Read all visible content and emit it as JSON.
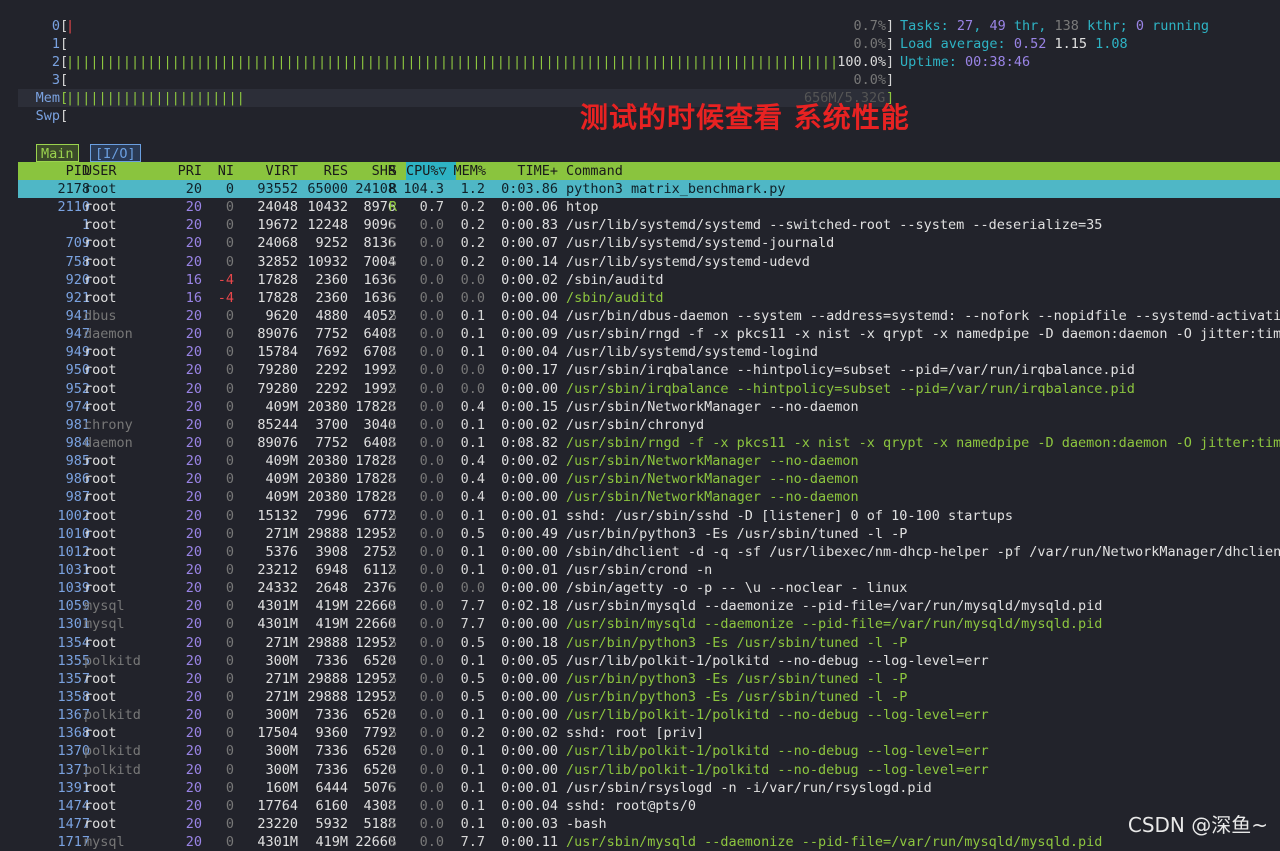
{
  "meters": {
    "cpus": [
      {
        "label": "0",
        "bar": "|",
        "bar_color": "red",
        "pct": "0.7%"
      },
      {
        "label": "1",
        "bar": "",
        "bar_color": "green",
        "pct": "0.0%"
      },
      {
        "label": "2",
        "bar": "||||||||||||||||||||||||||||||||||||||||||||||||||||||||||||||||||||||||||||||||||||||||||||||||||||||||||||",
        "bar_color": "green",
        "pct": "100.0%"
      },
      {
        "label": "3",
        "bar": "",
        "bar_color": "green",
        "pct": "0.0%"
      }
    ],
    "mem": {
      "label": "Mem",
      "bar": "|||||||||||||||||||||||||",
      "value": "656M/5.32G"
    },
    "swp": {
      "label": "Swp",
      "bar": "",
      "value": ""
    }
  },
  "header": {
    "tasks_label": "Tasks:",
    "tasks": "27",
    "thr_count": "49",
    "thr_label": "thr,",
    "kthr_count": "138",
    "kthr_label": "kthr;",
    "running": "0",
    "running_label": "running",
    "load_label": "Load average:",
    "load1": "0.52",
    "load5": "1.15",
    "load15": "1.08",
    "uptime_label": "Uptime:",
    "uptime": "00:38:46"
  },
  "overlay_text": "测试的时候查看 系统性能",
  "tabs": {
    "main": "Main",
    "io": "[I/O]"
  },
  "columns": {
    "pid": "PID",
    "user": "USER",
    "pri": "PRI",
    "ni": "NI",
    "virt": "VIRT",
    "res": "RES",
    "shr": "SHR",
    "s": "S",
    "cpu": "CPU%",
    "sort_icon": "▽",
    "mem": "MEM%",
    "time": "TIME+",
    "cmd": "Command"
  },
  "processes": [
    {
      "pid": "2178",
      "user": "root",
      "pri": "20",
      "ni": "0",
      "virt": "93552",
      "res": "65000",
      "shr": "24108",
      "s": "R",
      "cpu": "104.3",
      "mem": "1.2",
      "time": "0:03.86",
      "cmd": "python3 matrix_benchmark.py",
      "sel": true
    },
    {
      "pid": "2110",
      "user": "root",
      "pri": "20",
      "ni": "0",
      "virt": "24048",
      "res": "10432",
      "shr": "8976",
      "s": "R",
      "cpu": "0.7",
      "mem": "0.2",
      "time": "0:00.06",
      "cmd": "htop"
    },
    {
      "pid": "1",
      "user": "root",
      "pri": "20",
      "ni": "0",
      "virt": "19672",
      "res": "12248",
      "shr": "9096",
      "s": "S",
      "cpu": "0.0",
      "mem": "0.2",
      "time": "0:00.83",
      "cmd": "/usr/lib/systemd/systemd --switched-root --system --deserialize=35"
    },
    {
      "pid": "709",
      "user": "root",
      "pri": "20",
      "ni": "0",
      "virt": "24068",
      "res": "9252",
      "shr": "8136",
      "s": "S",
      "cpu": "0.0",
      "mem": "0.2",
      "time": "0:00.07",
      "cmd": "/usr/lib/systemd/systemd-journald"
    },
    {
      "pid": "758",
      "user": "root",
      "pri": "20",
      "ni": "0",
      "virt": "32852",
      "res": "10932",
      "shr": "7004",
      "s": "S",
      "cpu": "0.0",
      "mem": "0.2",
      "time": "0:00.14",
      "cmd": "/usr/lib/systemd/systemd-udevd"
    },
    {
      "pid": "920",
      "user": "root",
      "pri": "16",
      "ni": "-4",
      "virt": "17828",
      "res": "2360",
      "shr": "1636",
      "s": "S",
      "cpu": "0.0",
      "mem": "0.0",
      "time": "0:00.02",
      "cmd": "/sbin/auditd"
    },
    {
      "pid": "921",
      "user": "root",
      "pri": "16",
      "ni": "-4",
      "virt": "17828",
      "res": "2360",
      "shr": "1636",
      "s": "S",
      "cpu": "0.0",
      "mem": "0.0",
      "time": "0:00.00",
      "cmd": "/sbin/auditd",
      "thread": true
    },
    {
      "pid": "941",
      "user": "dbus",
      "pri": "20",
      "ni": "0",
      "virt": "9620",
      "res": "4880",
      "shr": "4052",
      "s": "S",
      "cpu": "0.0",
      "mem": "0.1",
      "time": "0:00.04",
      "cmd": "/usr/bin/dbus-daemon --system --address=systemd: --nofork --nopidfile --systemd-activati"
    },
    {
      "pid": "947",
      "user": "daemon",
      "pri": "20",
      "ni": "0",
      "virt": "89076",
      "res": "7752",
      "shr": "6408",
      "s": "S",
      "cpu": "0.0",
      "mem": "0.1",
      "time": "0:00.09",
      "cmd": "/usr/sbin/rngd -f -x pkcs11 -x nist -x qrypt -x namedpipe -D daemon:daemon -O jitter:tim"
    },
    {
      "pid": "949",
      "user": "root",
      "pri": "20",
      "ni": "0",
      "virt": "15784",
      "res": "7692",
      "shr": "6708",
      "s": "S",
      "cpu": "0.0",
      "mem": "0.1",
      "time": "0:00.04",
      "cmd": "/usr/lib/systemd/systemd-logind"
    },
    {
      "pid": "950",
      "user": "root",
      "pri": "20",
      "ni": "0",
      "virt": "79280",
      "res": "2292",
      "shr": "1992",
      "s": "S",
      "cpu": "0.0",
      "mem": "0.0",
      "time": "0:00.17",
      "cmd": "/usr/sbin/irqbalance --hintpolicy=subset --pid=/var/run/irqbalance.pid"
    },
    {
      "pid": "952",
      "user": "root",
      "pri": "20",
      "ni": "0",
      "virt": "79280",
      "res": "2292",
      "shr": "1992",
      "s": "S",
      "cpu": "0.0",
      "mem": "0.0",
      "time": "0:00.00",
      "cmd": "/usr/sbin/irqbalance --hintpolicy=subset --pid=/var/run/irqbalance.pid",
      "thread": true
    },
    {
      "pid": "974",
      "user": "root",
      "pri": "20",
      "ni": "0",
      "virt": "409M",
      "res": "20380",
      "shr": "17828",
      "s": "S",
      "cpu": "0.0",
      "mem": "0.4",
      "time": "0:00.15",
      "cmd": "/usr/sbin/NetworkManager --no-daemon"
    },
    {
      "pid": "981",
      "user": "chrony",
      "pri": "20",
      "ni": "0",
      "virt": "85244",
      "res": "3700",
      "shr": "3040",
      "s": "S",
      "cpu": "0.0",
      "mem": "0.1",
      "time": "0:00.02",
      "cmd": "/usr/sbin/chronyd"
    },
    {
      "pid": "984",
      "user": "daemon",
      "pri": "20",
      "ni": "0",
      "virt": "89076",
      "res": "7752",
      "shr": "6408",
      "s": "S",
      "cpu": "0.0",
      "mem": "0.1",
      "time": "0:08.82",
      "cmd": "/usr/sbin/rngd -f -x pkcs11 -x nist -x qrypt -x namedpipe -D daemon:daemon -O jitter:tim",
      "thread": true
    },
    {
      "pid": "985",
      "user": "root",
      "pri": "20",
      "ni": "0",
      "virt": "409M",
      "res": "20380",
      "shr": "17828",
      "s": "S",
      "cpu": "0.0",
      "mem": "0.4",
      "time": "0:00.02",
      "cmd": "/usr/sbin/NetworkManager --no-daemon",
      "thread": true
    },
    {
      "pid": "986",
      "user": "root",
      "pri": "20",
      "ni": "0",
      "virt": "409M",
      "res": "20380",
      "shr": "17828",
      "s": "S",
      "cpu": "0.0",
      "mem": "0.4",
      "time": "0:00.00",
      "cmd": "/usr/sbin/NetworkManager --no-daemon",
      "thread": true
    },
    {
      "pid": "987",
      "user": "root",
      "pri": "20",
      "ni": "0",
      "virt": "409M",
      "res": "20380",
      "shr": "17828",
      "s": "S",
      "cpu": "0.0",
      "mem": "0.4",
      "time": "0:00.00",
      "cmd": "/usr/sbin/NetworkManager --no-daemon",
      "thread": true
    },
    {
      "pid": "1002",
      "user": "root",
      "pri": "20",
      "ni": "0",
      "virt": "15132",
      "res": "7996",
      "shr": "6772",
      "s": "S",
      "cpu": "0.0",
      "mem": "0.1",
      "time": "0:00.01",
      "cmd": "sshd: /usr/sbin/sshd -D [listener] 0 of 10-100 startups"
    },
    {
      "pid": "1010",
      "user": "root",
      "pri": "20",
      "ni": "0",
      "virt": "271M",
      "res": "29888",
      "shr": "12952",
      "s": "S",
      "cpu": "0.0",
      "mem": "0.5",
      "time": "0:00.49",
      "cmd": "/usr/bin/python3 -Es /usr/sbin/tuned -l -P"
    },
    {
      "pid": "1012",
      "user": "root",
      "pri": "20",
      "ni": "0",
      "virt": "5376",
      "res": "3908",
      "shr": "2752",
      "s": "S",
      "cpu": "0.0",
      "mem": "0.1",
      "time": "0:00.00",
      "cmd": "/sbin/dhclient -d -q -sf /usr/libexec/nm-dhcp-helper -pf /var/run/NetworkManager/dhclien"
    },
    {
      "pid": "1031",
      "user": "root",
      "pri": "20",
      "ni": "0",
      "virt": "23212",
      "res": "6948",
      "shr": "6112",
      "s": "S",
      "cpu": "0.0",
      "mem": "0.1",
      "time": "0:00.01",
      "cmd": "/usr/sbin/crond -n"
    },
    {
      "pid": "1039",
      "user": "root",
      "pri": "20",
      "ni": "0",
      "virt": "24332",
      "res": "2648",
      "shr": "2376",
      "s": "S",
      "cpu": "0.0",
      "mem": "0.0",
      "time": "0:00.00",
      "cmd": "/sbin/agetty -o -p -- \\u --noclear - linux"
    },
    {
      "pid": "1059",
      "user": "mysql",
      "pri": "20",
      "ni": "0",
      "virt": "4301M",
      "res": "419M",
      "shr": "22660",
      "s": "S",
      "cpu": "0.0",
      "mem": "7.7",
      "time": "0:02.18",
      "cmd": "/usr/sbin/mysqld --daemonize --pid-file=/var/run/mysqld/mysqld.pid"
    },
    {
      "pid": "1301",
      "user": "mysql",
      "pri": "20",
      "ni": "0",
      "virt": "4301M",
      "res": "419M",
      "shr": "22660",
      "s": "S",
      "cpu": "0.0",
      "mem": "7.7",
      "time": "0:00.00",
      "cmd": "/usr/sbin/mysqld --daemonize --pid-file=/var/run/mysqld/mysqld.pid",
      "thread": true
    },
    {
      "pid": "1354",
      "user": "root",
      "pri": "20",
      "ni": "0",
      "virt": "271M",
      "res": "29888",
      "shr": "12952",
      "s": "S",
      "cpu": "0.0",
      "mem": "0.5",
      "time": "0:00.18",
      "cmd": "/usr/bin/python3 -Es /usr/sbin/tuned -l -P",
      "thread": true
    },
    {
      "pid": "1355",
      "user": "polkitd",
      "pri": "20",
      "ni": "0",
      "virt": "300M",
      "res": "7336",
      "shr": "6520",
      "s": "S",
      "cpu": "0.0",
      "mem": "0.1",
      "time": "0:00.05",
      "cmd": "/usr/lib/polkit-1/polkitd --no-debug --log-level=err"
    },
    {
      "pid": "1357",
      "user": "root",
      "pri": "20",
      "ni": "0",
      "virt": "271M",
      "res": "29888",
      "shr": "12952",
      "s": "S",
      "cpu": "0.0",
      "mem": "0.5",
      "time": "0:00.00",
      "cmd": "/usr/bin/python3 -Es /usr/sbin/tuned -l -P",
      "thread": true
    },
    {
      "pid": "1358",
      "user": "root",
      "pri": "20",
      "ni": "0",
      "virt": "271M",
      "res": "29888",
      "shr": "12952",
      "s": "S",
      "cpu": "0.0",
      "mem": "0.5",
      "time": "0:00.00",
      "cmd": "/usr/bin/python3 -Es /usr/sbin/tuned -l -P",
      "thread": true
    },
    {
      "pid": "1367",
      "user": "polkitd",
      "pri": "20",
      "ni": "0",
      "virt": "300M",
      "res": "7336",
      "shr": "6520",
      "s": "S",
      "cpu": "0.0",
      "mem": "0.1",
      "time": "0:00.00",
      "cmd": "/usr/lib/polkit-1/polkitd --no-debug --log-level=err",
      "thread": true
    },
    {
      "pid": "1368",
      "user": "root",
      "pri": "20",
      "ni": "0",
      "virt": "17504",
      "res": "9360",
      "shr": "7792",
      "s": "S",
      "cpu": "0.0",
      "mem": "0.2",
      "time": "0:00.02",
      "cmd": "sshd: root [priv]"
    },
    {
      "pid": "1370",
      "user": "polkitd",
      "pri": "20",
      "ni": "0",
      "virt": "300M",
      "res": "7336",
      "shr": "6520",
      "s": "S",
      "cpu": "0.0",
      "mem": "0.1",
      "time": "0:00.00",
      "cmd": "/usr/lib/polkit-1/polkitd --no-debug --log-level=err",
      "thread": true
    },
    {
      "pid": "1371",
      "user": "polkitd",
      "pri": "20",
      "ni": "0",
      "virt": "300M",
      "res": "7336",
      "shr": "6520",
      "s": "S",
      "cpu": "0.0",
      "mem": "0.1",
      "time": "0:00.00",
      "cmd": "/usr/lib/polkit-1/polkitd --no-debug --log-level=err",
      "thread": true
    },
    {
      "pid": "1391",
      "user": "root",
      "pri": "20",
      "ni": "0",
      "virt": "160M",
      "res": "6444",
      "shr": "5076",
      "s": "S",
      "cpu": "0.0",
      "mem": "0.1",
      "time": "0:00.01",
      "cmd": "/usr/sbin/rsyslogd -n -i/var/run/rsyslogd.pid"
    },
    {
      "pid": "1474",
      "user": "root",
      "pri": "20",
      "ni": "0",
      "virt": "17764",
      "res": "6160",
      "shr": "4308",
      "s": "S",
      "cpu": "0.0",
      "mem": "0.1",
      "time": "0:00.04",
      "cmd": "sshd: root@pts/0"
    },
    {
      "pid": "1477",
      "user": "root",
      "pri": "20",
      "ni": "0",
      "virt": "23220",
      "res": "5932",
      "shr": "5188",
      "s": "S",
      "cpu": "0.0",
      "mem": "0.1",
      "time": "0:00.03",
      "cmd": "-bash"
    },
    {
      "pid": "1717",
      "user": "mysql",
      "pri": "20",
      "ni": "0",
      "virt": "4301M",
      "res": "419M",
      "shr": "22660",
      "s": "S",
      "cpu": "0.0",
      "mem": "7.7",
      "time": "0:00.11",
      "cmd": "/usr/sbin/mysqld --daemonize --pid-file=/var/run/mysqld/mysqld.pid",
      "thread": true
    }
  ],
  "watermark": "CSDN @深鱼~"
}
